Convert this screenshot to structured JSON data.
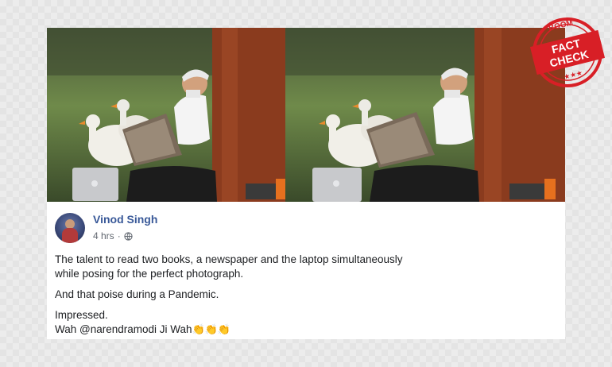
{
  "post": {
    "author_name": "Vinod Singh",
    "timestamp": "4 hrs",
    "separator": "·",
    "privacy_icon": "globe-icon",
    "line1": "The talent to read two books, a newspaper and the laptop simultaneously",
    "line2": "while posing for the perfect photograph.",
    "line3": "And that poise during a Pandemic.",
    "line4": "Impressed.",
    "line5": "Wah @narendramodi Ji Wah",
    "emoji": "👏👏👏"
  },
  "stamp": {
    "brand": "BOOM",
    "word1": "FACT",
    "word2": "CHECK",
    "stars": "★★★",
    "color": "#d81f26"
  },
  "colors": {
    "author_link": "#385898",
    "text": "#1c1e21",
    "meta": "#616770"
  }
}
